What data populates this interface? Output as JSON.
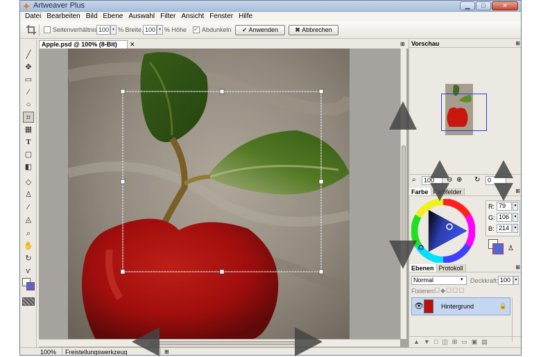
{
  "window": {
    "title": "Artweaver Plus",
    "buttons": {
      "minimize": "▁",
      "maximize": "□",
      "close": "✕"
    }
  },
  "menu": [
    "Datei",
    "Bearbeiten",
    "Bild",
    "Ebene",
    "Auswahl",
    "Filter",
    "Ansicht",
    "Fenster",
    "Hilfe"
  ],
  "options_bar": {
    "aspect_label": "Seitenverhältnis:",
    "width_value": "100",
    "width_label": "% Breite,",
    "height_value": "100",
    "height_label": "% Höhe",
    "darken_label": "Abdunkeln",
    "apply_label": "Anwenden",
    "cancel_label": "Abbrechen"
  },
  "document": {
    "tab_title": "Apple.psd @ 100% (8-Bit)",
    "close_glyph": "✕"
  },
  "status": {
    "zoom": "100%",
    "tool": "Freistellungswerkzeug"
  },
  "preview_panel": {
    "title": "Vorschau",
    "zoom_value": "100",
    "rotation_value": "0"
  },
  "color_panel": {
    "tabs": [
      "Farbe",
      "Farbfelder"
    ],
    "r_label": "R:",
    "r": "79",
    "g_label": "G:",
    "g": "106",
    "b_label": "B:",
    "b": "214",
    "foreground": "#4f6ad6",
    "background": "#ffffff"
  },
  "layers_panel": {
    "tabs": [
      "Ebenen",
      "Protokoll"
    ],
    "blend_mode": "Normal",
    "opacity_label": "Deckkraft:",
    "opacity": "100",
    "lock_label": "Fixieren:",
    "layer_name": "Hintergrund"
  }
}
